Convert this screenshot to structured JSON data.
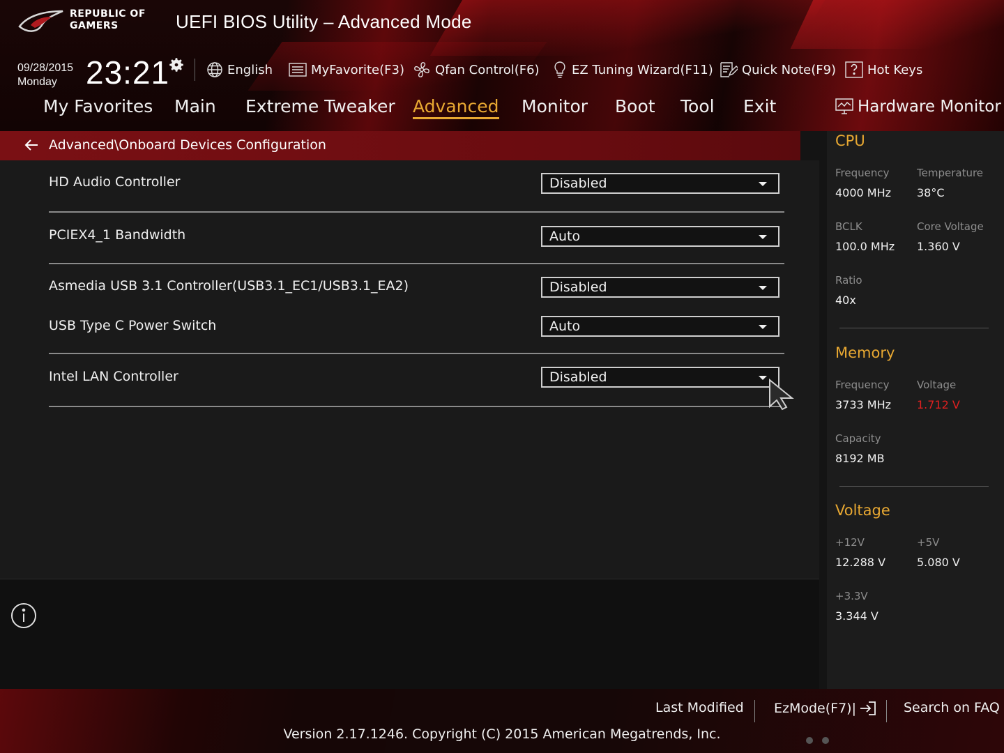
{
  "header": {
    "brand_line1": "REPUBLIC OF",
    "brand_line2": "GAMERS",
    "title": "UEFI BIOS Utility – Advanced Mode",
    "date": "09/28/2015",
    "day": "Monday",
    "time": "23:21"
  },
  "toolbar": {
    "language": "English",
    "myfavorite": "MyFavorite(F3)",
    "qfan": "Qfan Control(F6)",
    "ez_tuning": "EZ Tuning Wizard(F11)",
    "quick_note": "Quick Note(F9)",
    "hot_keys": "Hot Keys"
  },
  "nav": {
    "tabs": [
      "My Favorites",
      "Main",
      "Extreme Tweaker",
      "Advanced",
      "Monitor",
      "Boot",
      "Tool",
      "Exit"
    ],
    "active": "Advanced"
  },
  "breadcrumb": "Advanced\\Onboard Devices Configuration",
  "settings": [
    {
      "label": "HD Audio Controller",
      "value": "Disabled"
    },
    {
      "label": "PCIEX4_1 Bandwidth",
      "value": "Auto"
    },
    {
      "label": "Asmedia USB 3.1 Controller(USB3.1_EC1/USB3.1_EA2)",
      "value": "Disabled"
    },
    {
      "label": "USB Type C Power Switch",
      "value": "Auto"
    },
    {
      "label": "Intel LAN Controller",
      "value": "Disabled"
    }
  ],
  "hardware_monitor": {
    "title": "Hardware Monitor",
    "cpu": {
      "heading": "CPU",
      "frequency_label": "Frequency",
      "frequency": "4000 MHz",
      "temperature_label": "Temperature",
      "temperature": "38°C",
      "bclk_label": "BCLK",
      "bclk": "100.0 MHz",
      "core_voltage_label": "Core Voltage",
      "core_voltage": "1.360 V",
      "ratio_label": "Ratio",
      "ratio": "40x"
    },
    "memory": {
      "heading": "Memory",
      "frequency_label": "Frequency",
      "frequency": "3733 MHz",
      "voltage_label": "Voltage",
      "voltage": "1.712 V",
      "capacity_label": "Capacity",
      "capacity": "8192 MB"
    },
    "voltage": {
      "heading": "Voltage",
      "v12_label": "+12V",
      "v12": "12.288 V",
      "v5_label": "+5V",
      "v5": "5.080 V",
      "v33_label": "+3.3V",
      "v33": "3.344 V"
    }
  },
  "footer": {
    "last_modified": "Last Modified",
    "ezmode": "EzMode(F7)|",
    "search_faq": "Search on FAQ",
    "version": "Version 2.17.1246. Copyright (C) 2015 American Megatrends, Inc."
  },
  "colors": {
    "accent": "#e8a832",
    "warning": "#e02020",
    "header_red": "#7a1014"
  }
}
